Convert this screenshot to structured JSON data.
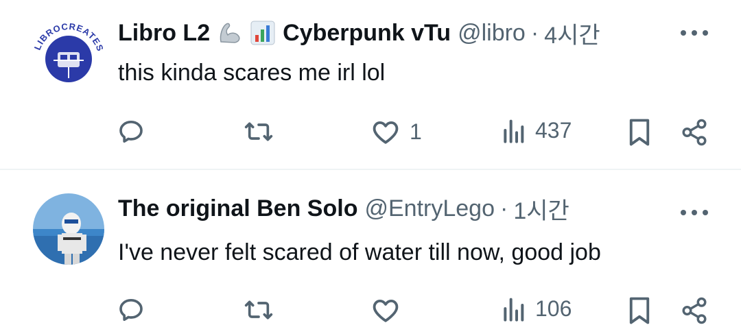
{
  "tweets": [
    {
      "display_name": "Libro L2",
      "badges": [
        "flexed-biceps-emoji",
        "bar-chart-emoji"
      ],
      "display_name_cont": "Cyberpunk vTu",
      "handle": "@libro",
      "separator": "·",
      "time": "4시간",
      "text": "this kinda scares me irl lol",
      "likes": "1",
      "views": "437",
      "avatar_text": "LIBROCREATES"
    },
    {
      "display_name": "The original Ben Solo",
      "handle": "@EntryLego",
      "separator": "·",
      "time": "1시간",
      "text": "I've never felt scared of water till now, good job",
      "likes": "",
      "views": "106"
    }
  ],
  "colors": {
    "text": "#0f1419",
    "secondary": "#536471",
    "divider": "#eff3f4",
    "avatar_blue": "#2b3aa8"
  },
  "icons": [
    "reply-icon",
    "retweet-icon",
    "heart-icon",
    "views-icon",
    "bookmark-icon",
    "share-icon",
    "more-icon"
  ]
}
